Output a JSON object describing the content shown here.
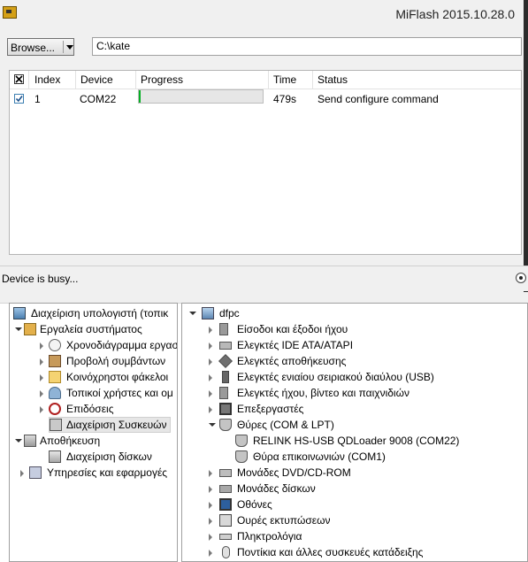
{
  "miflash": {
    "title": "MiFlash 2015.10.28.0",
    "browse_label": "Browse...",
    "path_value": "C:\\kate",
    "columns": [
      "Index",
      "Device",
      "Progress",
      "Time",
      "Status"
    ],
    "rows": [
      {
        "index": "1",
        "device": "COM22",
        "progress": 0.01,
        "time": "479s",
        "status": "Send configure command"
      }
    ],
    "status_text": "Device is busy..."
  },
  "compmgmt": {
    "left_tree": {
      "root": "Διαχείριση υπολογιστή (τοπικ",
      "system_tools": "Εργαλεία συστήματος",
      "task_scheduler": "Χρονοδιάγραμμα εργασ",
      "event_viewer": "Προβολή συμβάντων",
      "shared_folders": "Κοινόχρηστοι φάκελοι",
      "local_users": "Τοπικοί χρήστες και ομ",
      "performance": "Επιδόσεις",
      "device_manager": "Διαχείριση Συσκευών",
      "storage": "Αποθήκευση",
      "disk_management": "Διαχείριση δίσκων",
      "services": "Υπηρεσίες και εφαρμογές"
    },
    "right_tree": {
      "computer": "dfpc",
      "audio_io": "Είσοδοι και έξοδοι ήχου",
      "ide": "Ελεγκτές IDE ATA/ATAPI",
      "storage_ctrl": "Ελεγκτές αποθήκευσης",
      "usb": "Ελεγκτές ενιαίου σειριακού διαύλου (USB)",
      "sound": "Ελεγκτές ήχου, βίντεο και παιχνιδιών",
      "processors": "Επεξεργαστές",
      "ports": "Θύρες (COM & LPT)",
      "port_relink": "RELINK HS-USB QDLoader 9008 (COM22)",
      "port_com1": "Θύρα επικοινωνιών (COM1)",
      "dvd": "Μονάδες DVD/CD-ROM",
      "disks": "Μονάδες δίσκων",
      "monitors": "Οθόνες",
      "print_queues": "Ουρές εκτυπώσεων",
      "keyboards": "Πληκτρολόγια",
      "mice": "Ποντίκια και άλλες συσκευές κατάδειξης"
    }
  },
  "colors": {
    "progress_fill": "#06b025",
    "window_bg": "#f0f0f0"
  }
}
